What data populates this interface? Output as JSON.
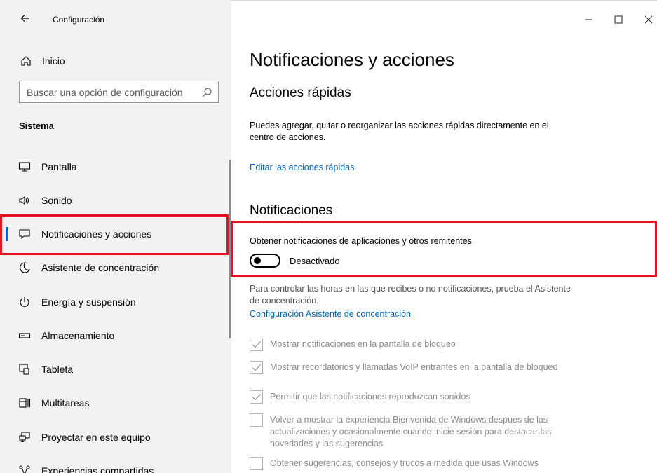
{
  "window": {
    "title": "Configuración",
    "back_icon": "arrow-left-icon",
    "caption": {
      "minimize": "–",
      "maximize": "☐",
      "close": "✕"
    }
  },
  "sidebar": {
    "home_label": "Inicio",
    "search_placeholder": "Buscar una opción de configuración",
    "section_title": "Sistema",
    "items": [
      {
        "label": "Pantalla",
        "icon": "monitor-icon"
      },
      {
        "label": "Sonido",
        "icon": "speaker-icon"
      },
      {
        "label": "Notificaciones y acciones",
        "icon": "message-icon",
        "active": true
      },
      {
        "label": "Asistente de concentración",
        "icon": "moon-icon"
      },
      {
        "label": "Energía y suspensión",
        "icon": "power-icon"
      },
      {
        "label": "Almacenamiento",
        "icon": "storage-icon"
      },
      {
        "label": "Tableta",
        "icon": "tablet-icon"
      },
      {
        "label": "Multitareas",
        "icon": "multitask-icon"
      },
      {
        "label": "Proyectar en este equipo",
        "icon": "project-icon"
      },
      {
        "label": "Experiencias compartidas",
        "icon": "share-icon"
      }
    ]
  },
  "main": {
    "title": "Notificaciones y acciones",
    "quick_actions": {
      "heading": "Acciones rápidas",
      "description": "Puedes agregar, quitar o reorganizar las acciones rápidas directamente en el centro de acciones.",
      "link": "Editar las acciones rápidas"
    },
    "notifications": {
      "heading": "Notificaciones",
      "toggle_title": "Obtener notificaciones de aplicaciones y otros remitentes",
      "toggle_state": "Desactivado",
      "focus_text": "Para controlar las horas en las que recibes o no notificaciones, prueba el Asistente de concentración.",
      "focus_link": "Configuración Asistente de concentración",
      "checkboxes": [
        {
          "label": "Mostrar notificaciones en la pantalla de bloqueo",
          "checked": true
        },
        {
          "label": "Mostrar recordatorios y llamadas VoIP entrantes en la pantalla de bloqueo",
          "checked": true
        },
        {
          "label": "Permitir que las notificaciones reproduzcan sonidos",
          "checked": true
        },
        {
          "label": "Volver a mostrar la experiencia Bienvenida de Windows después de las actualizaciones y ocasionalmente cuando inicie sesión para destacar las novedades y las sugerencias",
          "checked": false
        },
        {
          "label": "Obtener sugerencias, consejos y trucos a medida que usas Windows",
          "checked": false
        }
      ]
    }
  },
  "colors": {
    "accent": "#0067c0",
    "highlight": "#e81123",
    "sidebar_bg": "#f2f2f2"
  }
}
